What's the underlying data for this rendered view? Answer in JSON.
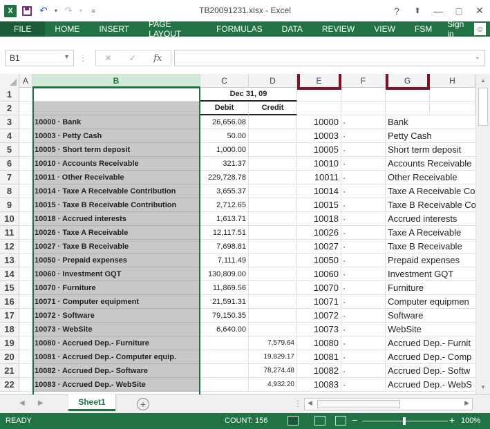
{
  "title_bar": {
    "title": "TB20091231.xlsx - Excel",
    "excel_logo": "X",
    "help": "?",
    "minimize": "—",
    "restore": "□",
    "close": "✕"
  },
  "ribbon": {
    "tabs": [
      "FILE",
      "HOME",
      "INSERT",
      "PAGE LAYOUT",
      "FORMULAS",
      "DATA",
      "REVIEW",
      "VIEW",
      "FSM"
    ],
    "sign_in": "Sign in"
  },
  "formula_bar": {
    "name_box": "B1",
    "formula": ""
  },
  "columns": [
    "A",
    "B",
    "C",
    "D",
    "E",
    "F",
    "G",
    "H"
  ],
  "header_rows": {
    "date": "Dec 31, 09",
    "debit": "Debit",
    "credit": "Credit"
  },
  "rows": [
    {
      "n": "3",
      "b": "10000 · Bank",
      "c": "26,656.08",
      "d": "",
      "e": "10000",
      "f": "·",
      "g": "Bank"
    },
    {
      "n": "4",
      "b": "10003 · Petty Cash",
      "c": "50.00",
      "d": "",
      "e": "10003",
      "f": "·",
      "g": "Petty Cash"
    },
    {
      "n": "5",
      "b": "10005 · Short term deposit",
      "c": "1,000.00",
      "d": "",
      "e": "10005",
      "f": "·",
      "g": "Short term deposit"
    },
    {
      "n": "6",
      "b": "10010 · Accounts Receivable",
      "c": "321.37",
      "d": "",
      "e": "10010",
      "f": "·",
      "g": "Accounts Receivable"
    },
    {
      "n": "7",
      "b": "10011 · Other Receivable",
      "c": "229,728.78",
      "d": "",
      "e": "10011",
      "f": "·",
      "g": "Other Receivable"
    },
    {
      "n": "8",
      "b": "10014 · Taxe A Receivable Contribution",
      "c": "3,655.37",
      "d": "",
      "e": "10014",
      "f": "·",
      "g": "Taxe A Receivable Co"
    },
    {
      "n": "9",
      "b": "10015 · Taxe B Receivable Contribution",
      "c": "2,712.65",
      "d": "",
      "e": "10015",
      "f": "·",
      "g": "Taxe B Receivable Co"
    },
    {
      "n": "10",
      "b": "10018 · Accrued interests",
      "c": "1,613.71",
      "d": "",
      "e": "10018",
      "f": "·",
      "g": "Accrued interests"
    },
    {
      "n": "11",
      "b": "10026 · Taxe A Receivable",
      "c": "12,117.51",
      "d": "",
      "e": "10026",
      "f": "·",
      "g": "Taxe A Receivable"
    },
    {
      "n": "12",
      "b": "10027 · Taxe B Receivable",
      "c": "7,698.81",
      "d": "",
      "e": "10027",
      "f": "·",
      "g": "Taxe B Receivable"
    },
    {
      "n": "13",
      "b": "10050 · Prepaid expenses",
      "c": "7,111.49",
      "d": "",
      "e": "10050",
      "f": "·",
      "g": "Prepaid expenses"
    },
    {
      "n": "14",
      "b": "10060 · Investment GQT",
      "c": "130,809.00",
      "d": "",
      "e": "10060",
      "f": "·",
      "g": "Investment GQT"
    },
    {
      "n": "15",
      "b": "10070 · Furniture",
      "c": "11,869.56",
      "d": "",
      "e": "10070",
      "f": "·",
      "g": "Furniture"
    },
    {
      "n": "16",
      "b": "10071 · Computer equipment",
      "c": "21,591.31",
      "d": "",
      "e": "10071",
      "f": "·",
      "g": "Computer equipmen"
    },
    {
      "n": "17",
      "b": "10072 · Software",
      "c": "79,150.35",
      "d": "",
      "e": "10072",
      "f": "·",
      "g": "Software"
    },
    {
      "n": "18",
      "b": "10073 · WebSite",
      "c": "6,640.00",
      "d": "",
      "e": "10073",
      "f": "·",
      "g": "WebSite"
    },
    {
      "n": "19",
      "b": "10080 · Accrued Dep.- Furniture",
      "c": "",
      "d": "7,579.64",
      "e": "10080",
      "f": "·",
      "g": "Accrued Dep.- Furnit"
    },
    {
      "n": "20",
      "b": "10081 · Accrued Dep.- Computer equip.",
      "c": "",
      "d": "19,829.17",
      "e": "10081",
      "f": "·",
      "g": "Accrued Dep.- Comp"
    },
    {
      "n": "21",
      "b": "10082 · Accrued Dep.- Software",
      "c": "",
      "d": "78,274.48",
      "e": "10082",
      "f": "·",
      "g": "Accrued Dep.- Softw"
    },
    {
      "n": "22",
      "b": "10083 · Accrued Dep.- WebSite",
      "c": "",
      "d": "4,932.20",
      "e": "10083",
      "f": "·",
      "g": "Accrued Dep.- WebS"
    }
  ],
  "sheet_tabs": [
    "Sheet1"
  ],
  "status_bar": {
    "ready": "READY",
    "count": "COUNT: 156",
    "zoom": "100%"
  },
  "colors": {
    "excel_green": "#217346",
    "highlight_red": "#7b1428",
    "selected_fill": "#c8c8c8"
  }
}
